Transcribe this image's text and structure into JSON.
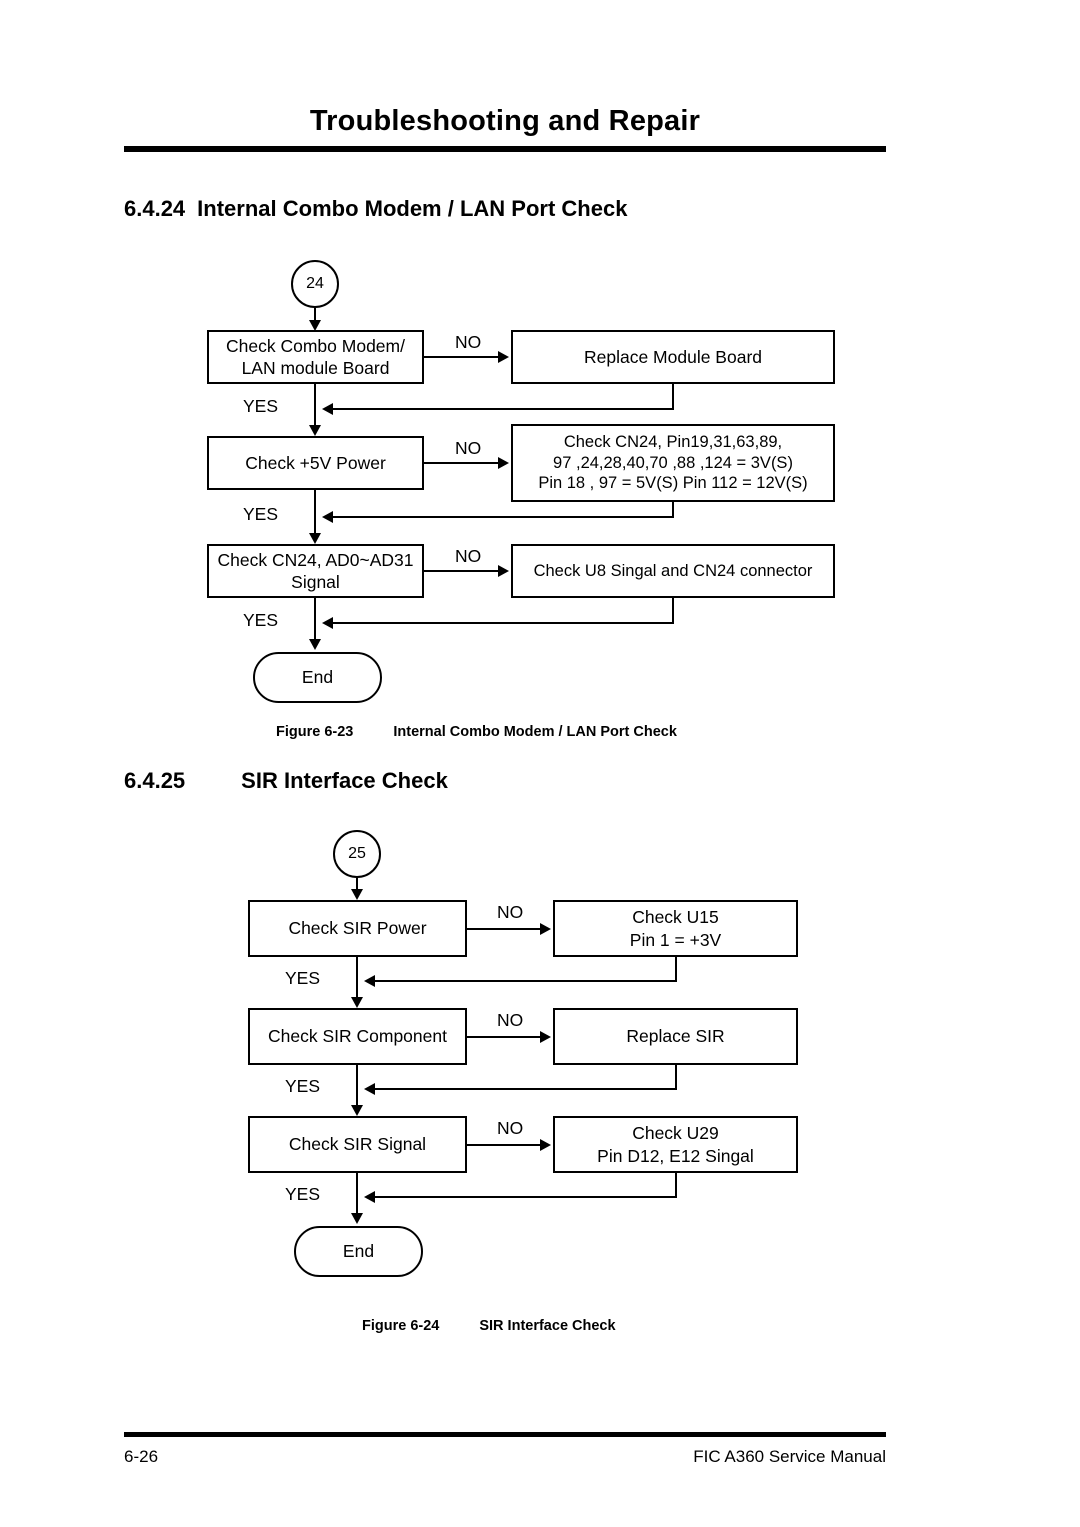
{
  "header": {
    "title": "Troubleshooting and Repair"
  },
  "sections": [
    {
      "number": "6.4.24",
      "title": "Internal Combo Modem / LAN Port Check",
      "figure": {
        "label": "Figure 6-23",
        "text": "Internal Combo Modem / LAN Port Check"
      },
      "flowchart": {
        "start_node": "24",
        "end_node": "End",
        "yes_label": "YES",
        "no_label": "NO",
        "steps": [
          {
            "decision": "Check Combo Modem/\nLAN module Board",
            "decision_line1": "Check Combo Modem/",
            "decision_line2": "LAN module Board",
            "no_action": "Replace Module Board"
          },
          {
            "decision": "Check +5V Power",
            "decision_line1": "Check +5V Power",
            "decision_line2": "",
            "no_action_line1": "Check  CN24, Pin19,31,63,89,",
            "no_action_line2": "97 ,24,28,40,70 ,88 ,124 = 3V(S)",
            "no_action_line3": "Pin 18 , 97 = 5V(S) Pin 112 = 12V(S)"
          },
          {
            "decision_line1": "Check CN24, AD0~AD31",
            "decision_line2": "Signal",
            "no_action": "Check U8 Singal and CN24 connector"
          }
        ]
      }
    },
    {
      "number": "6.4.25",
      "title": "SIR Interface Check",
      "figure": {
        "label": "Figure 6-24",
        "text": "SIR Interface Check"
      },
      "flowchart": {
        "start_node": "25",
        "end_node": "End",
        "yes_label": "YES",
        "no_label": "NO",
        "steps": [
          {
            "decision_line1": "Check SIR Power",
            "no_action_line1": "Check U15",
            "no_action_line2": "Pin 1 = +3V"
          },
          {
            "decision_line1": "Check SIR Component",
            "no_action_line1": "Replace SIR"
          },
          {
            "decision_line1": "Check SIR Signal",
            "no_action_line1": "Check U29",
            "no_action_line2": "Pin D12, E12 Singal"
          }
        ]
      }
    }
  ],
  "footer": {
    "page_number": "6-26",
    "manual_title": "FIC A360 Service Manual"
  }
}
